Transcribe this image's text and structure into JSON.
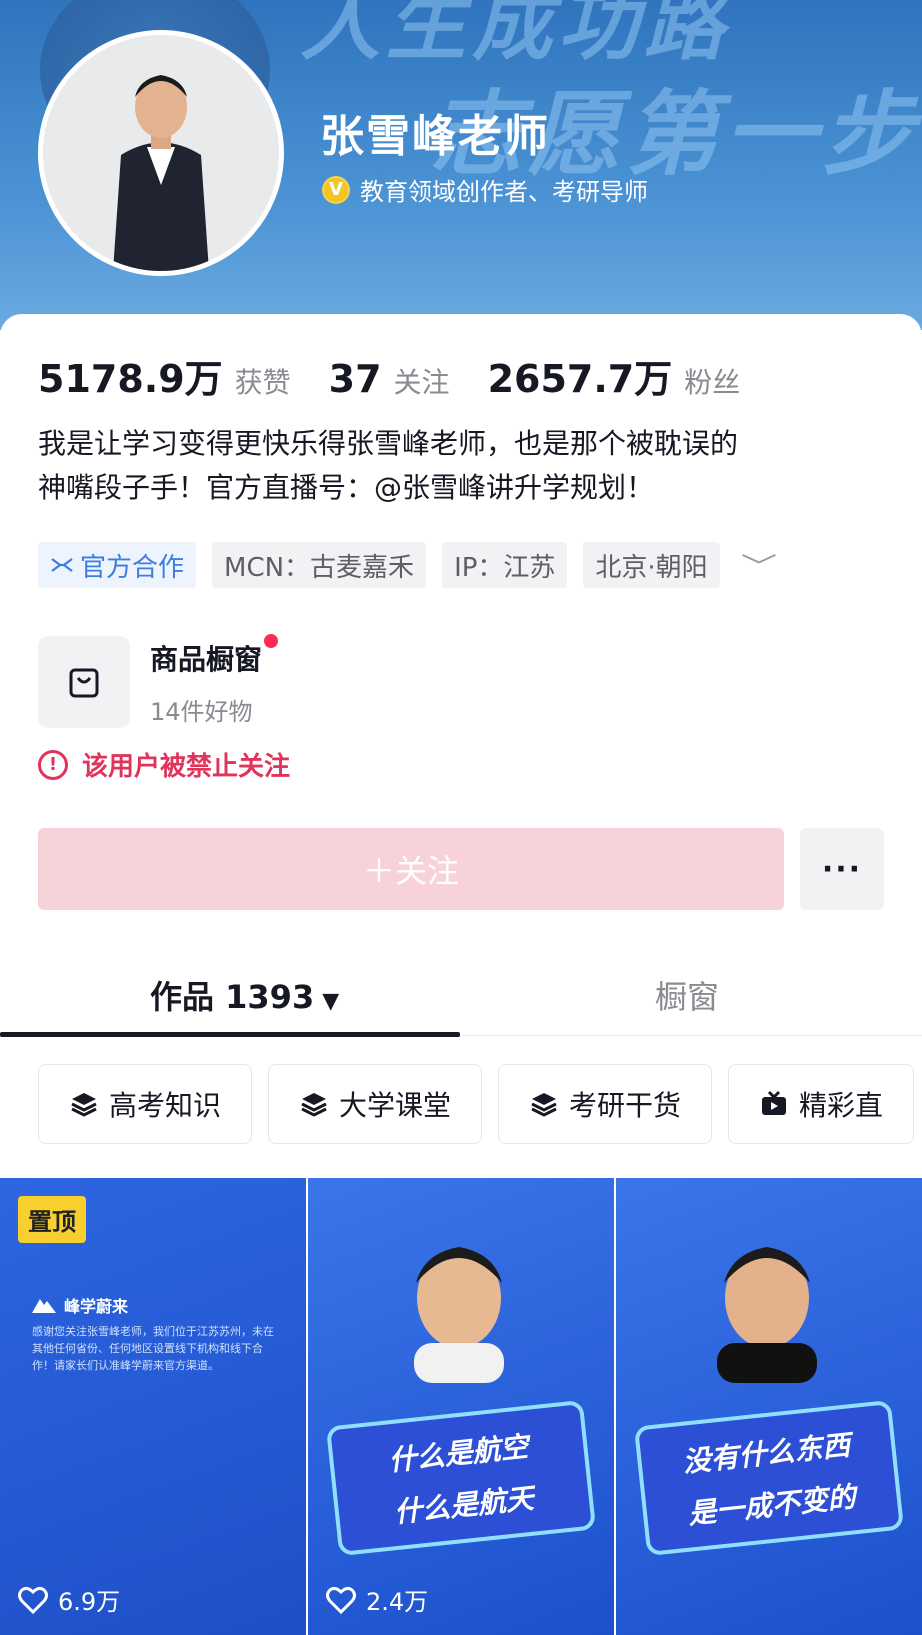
{
  "header": {
    "banner_line1": "人生成功路",
    "banner_line2": "志愿第一步",
    "name": "张雪峰老师",
    "verify_badge": "V",
    "verify_text": "教育领域创作者、考研导师"
  },
  "stats": [
    {
      "num": "5178.9万",
      "label": "获赞"
    },
    {
      "num": "37",
      "label": "关注"
    },
    {
      "num": "2657.7万",
      "label": "粉丝"
    }
  ],
  "bio": {
    "line1": "我是让学习变得更快乐得张雪峰老师，也是那个被耽误的",
    "line2": "神嘴段子手！官方直播号：@张雪峰讲升学规划！"
  },
  "tags": {
    "official": "官方合作",
    "mcn": "MCN：古麦嘉禾",
    "ip": "IP：江苏",
    "location": "北京·朝阳",
    "expand": "﹀"
  },
  "shop": {
    "title": "商品橱窗",
    "subtitle": "14件好物"
  },
  "ban_notice": {
    "icon": "!",
    "text": "该用户被禁止关注"
  },
  "actions": {
    "follow_label": "＋关注",
    "more_label": "···"
  },
  "tabs": {
    "works_label": "作品 1393",
    "works_caret": "▼",
    "shop_label": "橱窗"
  },
  "collections": [
    {
      "label": "高考知识",
      "icon": "layers-icon"
    },
    {
      "label": "大学课堂",
      "icon": "layers-icon"
    },
    {
      "label": "考研干货",
      "icon": "layers-icon"
    },
    {
      "label": "精彩直",
      "icon": "tv-icon"
    }
  ],
  "videos": [
    {
      "pin": "置顶",
      "brand": "峰学蔚来",
      "notice": "感谢您关注张雪峰老师，我们位于江苏苏州，未在其他任何省份、任何地区设置线下机构和线下合作！请家长们认准峰学蔚来官方渠道。",
      "likes": "6.9万"
    },
    {
      "line1": "什么是航空",
      "line2": "什么是航天",
      "likes": "2.4万"
    },
    {
      "line1": "没有什么东西",
      "line2": "是一成不变的",
      "likes": ""
    }
  ],
  "colors": {
    "accent": "#fe2c55",
    "follow_disabled": "#f8d2d9",
    "banner": "#3b84cc",
    "ban_text": "#e0345a",
    "official_tag": "#3d7de0"
  }
}
